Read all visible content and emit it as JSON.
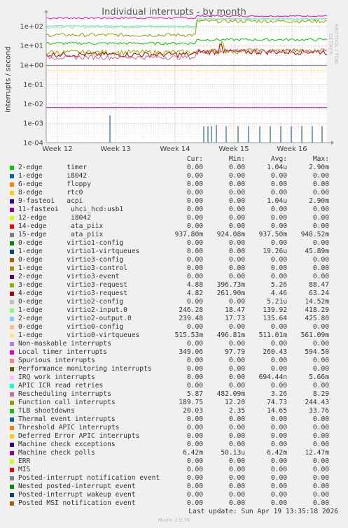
{
  "chart_data": {
    "type": "line",
    "title": "Individual interrupts - by month",
    "ylabel": "interrupts / second",
    "yscale": "log",
    "yticks": [
      "1e-04",
      "1e-03",
      "1e-02",
      "1e-01",
      "1e+00",
      "1e+01",
      "1e+02"
    ],
    "xticks": [
      "Week 12",
      "Week 13",
      "Week 14",
      "Week 15",
      "Week 16"
    ],
    "ylim": [
      0.0001,
      300
    ],
    "grid": true,
    "legend_placement": "bottom",
    "columns": [
      "Cur:",
      "Min:",
      "Avg:",
      "Max:"
    ],
    "series": [
      {
        "name": "2-edge      timer",
        "color": "#00cc00",
        "cur": "0.00",
        "min": "0.00",
        "avg": "1.04u",
        "max": "2.90m"
      },
      {
        "name": "1-edge      i8042",
        "color": "#0066b3",
        "cur": "0.00",
        "min": "0.00",
        "avg": "0.00",
        "max": "0.00"
      },
      {
        "name": "6-edge      floppy",
        "color": "#ff8000",
        "cur": "0.00",
        "min": "0.00",
        "avg": "0.00",
        "max": "0.00"
      },
      {
        "name": "8-edge      rtc0",
        "color": "#ffcc00",
        "cur": "0.00",
        "min": "0.00",
        "avg": "0.00",
        "max": "0.00"
      },
      {
        "name": "9-fasteoi   acpi",
        "color": "#330099",
        "cur": "0.00",
        "min": "0.00",
        "avg": "1.04u",
        "max": "2.90m"
      },
      {
        "name": "11-fasteoi   uhci_hcd:usb1",
        "color": "#990099",
        "cur": "0.00",
        "min": "0.00",
        "avg": "0.00",
        "max": "0.00"
      },
      {
        "name": "12-edge      i8042",
        "color": "#ccff00",
        "cur": "0.00",
        "min": "0.00",
        "avg": "0.00",
        "max": "0.00"
      },
      {
        "name": "14-edge      ata_piix",
        "color": "#ff0000",
        "cur": "0.00",
        "min": "0.00",
        "avg": "0.00",
        "max": "0.00"
      },
      {
        "name": "15-edge      ata_piix",
        "color": "#808080",
        "cur": "937.80m",
        "min": "924.08m",
        "avg": "937.50m",
        "max": "948.52m"
      },
      {
        "name": "0-edge      virtio1-config",
        "color": "#008f00",
        "cur": "0.00",
        "min": "0.00",
        "avg": "0.00",
        "max": "0.00"
      },
      {
        "name": "1-edge      virtio1-virtqueues",
        "color": "#00487d",
        "cur": "0.00",
        "min": "0.00",
        "avg": "19.26u",
        "max": "45.89m"
      },
      {
        "name": "0-edge      virtio3-config",
        "color": "#b35a00",
        "cur": "0.00",
        "min": "0.00",
        "avg": "0.00",
        "max": "0.00"
      },
      {
        "name": "1-edge      virtio3-control",
        "color": "#b38f00",
        "cur": "0.00",
        "min": "0.00",
        "avg": "0.00",
        "max": "0.00"
      },
      {
        "name": "2-edge      virtio3-event",
        "color": "#6b006b",
        "cur": "0.00",
        "min": "0.00",
        "avg": "0.00",
        "max": "0.00"
      },
      {
        "name": "3-edge      virtio3-request",
        "color": "#8fb300",
        "cur": "4.88",
        "min": "396.73m",
        "avg": "5.26",
        "max": "88.47"
      },
      {
        "name": "4-edge      virtio3-request",
        "color": "#b30000",
        "cur": "4.82",
        "min": "261.90m",
        "avg": "4.46",
        "max": "63.24"
      },
      {
        "name": "0-edge      virtio2-config",
        "color": "#bebebe",
        "cur": "0.00",
        "min": "0.00",
        "avg": "5.21u",
        "max": "14.52m"
      },
      {
        "name": "1-edge      virtio2-input.0",
        "color": "#80ff80",
        "cur": "246.28",
        "min": "18.47",
        "avg": "139.92",
        "max": "418.29"
      },
      {
        "name": "2-edge      virtio2-output.0",
        "color": "#80c9ff",
        "cur": "239.48",
        "min": "17.73",
        "avg": "135.64",
        "max": "425.80"
      },
      {
        "name": "0-edge      virtio0-config",
        "color": "#ffc080",
        "cur": "0.00",
        "min": "0.00",
        "avg": "0.00",
        "max": "0.00"
      },
      {
        "name": "1-edge      virtio0-virtqueues",
        "color": "#ffe680",
        "cur": "515.53m",
        "min": "496.81m",
        "avg": "511.01m",
        "max": "561.09m"
      },
      {
        "name": "Non-maskable interrupts",
        "color": "#aa80ff",
        "cur": "0.00",
        "min": "0.00",
        "avg": "0.00",
        "max": "0.00"
      },
      {
        "name": "Local timer interrupts",
        "color": "#ee00cc",
        "cur": "349.06",
        "min": "97.79",
        "avg": "260.43",
        "max": "594.50"
      },
      {
        "name": "Spurious interrupts",
        "color": "#ff8080",
        "cur": "0.00",
        "min": "0.00",
        "avg": "0.00",
        "max": "0.00"
      },
      {
        "name": "Performance monitoring interrupts",
        "color": "#666600",
        "cur": "0.00",
        "min": "0.00",
        "avg": "0.00",
        "max": "0.00"
      },
      {
        "name": "IRQ work interrupts",
        "color": "#ffbfff",
        "cur": "0.00",
        "min": "0.00",
        "avg": "694.44n",
        "max": "5.66m"
      },
      {
        "name": "APIC ICR read retries",
        "color": "#00ffcc",
        "cur": "0.00",
        "min": "0.00",
        "avg": "0.00",
        "max": "0.00"
      },
      {
        "name": "Rescheduling interrupts",
        "color": "#cc6699",
        "cur": "5.87",
        "min": "482.09m",
        "avg": "3.26",
        "max": "8.29"
      },
      {
        "name": "Function call interrupts",
        "color": "#999900",
        "cur": "189.75",
        "min": "12.20",
        "avg": "74.73",
        "max": "244.43"
      },
      {
        "name": "TLB shootdowns",
        "color": "#00cc00",
        "cur": "20.03",
        "min": "2.35",
        "avg": "14.65",
        "max": "33.76"
      },
      {
        "name": "Thermal event interrupts",
        "color": "#0066b3",
        "cur": "0.00",
        "min": "0.00",
        "avg": "0.00",
        "max": "0.00"
      },
      {
        "name": "Threshold APIC interrupts",
        "color": "#ff8000",
        "cur": "0.00",
        "min": "0.00",
        "avg": "0.00",
        "max": "0.00"
      },
      {
        "name": "Deferred Error APIC interrupts",
        "color": "#ffcc00",
        "cur": "0.00",
        "min": "0.00",
        "avg": "0.00",
        "max": "0.00"
      },
      {
        "name": "Machine check exceptions",
        "color": "#330099",
        "cur": "0.00",
        "min": "0.00",
        "avg": "0.00",
        "max": "0.00"
      },
      {
        "name": "Machine check polls",
        "color": "#990099",
        "cur": "6.42m",
        "min": "50.13u",
        "avg": "6.42m",
        "max": "12.47m"
      },
      {
        "name": "ERR",
        "color": "#ccff00",
        "cur": "0.00",
        "min": "0.00",
        "avg": "0.00",
        "max": "0.00"
      },
      {
        "name": "MIS",
        "color": "#ff0000",
        "cur": "0.00",
        "min": "0.00",
        "avg": "0.00",
        "max": "0.00"
      },
      {
        "name": "Posted-interrupt notification event",
        "color": "#808080",
        "cur": "0.00",
        "min": "0.00",
        "avg": "0.00",
        "max": "0.00"
      },
      {
        "name": "Nested posted-interrupt event",
        "color": "#008f00",
        "cur": "0.00",
        "min": "0.00",
        "avg": "0.00",
        "max": "0.00"
      },
      {
        "name": "Posted-interrupt wakeup event",
        "color": "#00487d",
        "cur": "0.00",
        "min": "0.00",
        "avg": "0.00",
        "max": "0.00"
      },
      {
        "name": "Posted MSI notification event",
        "color": "#b35a00",
        "cur": "0.00",
        "min": "0.00",
        "avg": "0.00",
        "max": "0.00"
      }
    ]
  },
  "side_credit": "RRDTOOL / TOBI OETIKER",
  "last_update": "Last update: Sun Apr 19 13:35:18 2026",
  "footer": "Munin 2.0.76"
}
